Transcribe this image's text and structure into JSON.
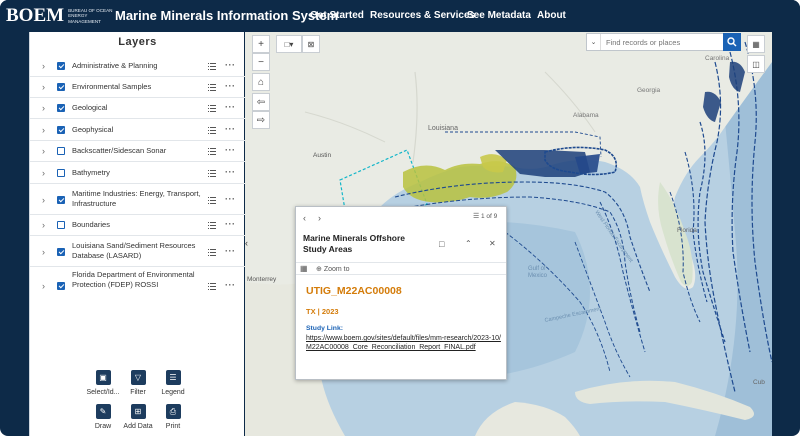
{
  "header": {
    "logo_mark": "BOEM",
    "logo_sub": "Bureau of Ocean Energy Management",
    "title": "Marine Minerals Information System",
    "nav": [
      "Get Started",
      "Resources & Services",
      "See Metadata",
      "About"
    ]
  },
  "layers_panel": {
    "title": "Layers",
    "items": [
      {
        "label": "Administrative & Planning",
        "checked": true
      },
      {
        "label": "Environmental Samples",
        "checked": true
      },
      {
        "label": "Geological",
        "checked": true
      },
      {
        "label": "Geophysical",
        "checked": true
      },
      {
        "label": "Backscatter/Sidescan Sonar",
        "checked": false
      },
      {
        "label": "Bathymetry",
        "checked": false
      },
      {
        "label": "Maritime Industries: Energy, Transport, Infrastructure",
        "checked": true
      },
      {
        "label": "Boundaries",
        "checked": false
      },
      {
        "label": "Louisiana Sand/Sediment Resources Database (LASARD)",
        "checked": true
      },
      {
        "label": "Florida Department of Environmental Protection (FDEP) ROSSI",
        "checked": true
      }
    ]
  },
  "tools": [
    {
      "label": "Select/Id...",
      "icon": "select-icon"
    },
    {
      "label": "Filter",
      "icon": "filter-icon"
    },
    {
      "label": "Legend",
      "icon": "legend-icon"
    },
    {
      "label": "Draw",
      "icon": "draw-icon"
    },
    {
      "label": "Add Data",
      "icon": "add-data-icon"
    },
    {
      "label": "Print",
      "icon": "print-icon"
    }
  ],
  "search": {
    "placeholder": "Find records or places"
  },
  "map_labels": [
    "Louisiana",
    "Austin",
    "Monterrey",
    "Florida",
    "Gulf of Mexico",
    "Campeche Escarpment",
    "West Florida Escarpment",
    "Georgia",
    "Carolina",
    "Cuba",
    "Alabama",
    "kas"
  ],
  "popup": {
    "count": "1 of 9",
    "layer_title": "Marine Minerals Offshore Study Areas",
    "zoom_label": "Zoom to",
    "record_title": "UTIG_M22AC00008",
    "record_sub": "TX | 2023",
    "link_label": "Study Link:",
    "link_url": "https://www.boem.gov/sites/default/files/mm-research/2023-10/M22AC00008_Core_Reconciliation_Report_FINAL.pdf"
  }
}
